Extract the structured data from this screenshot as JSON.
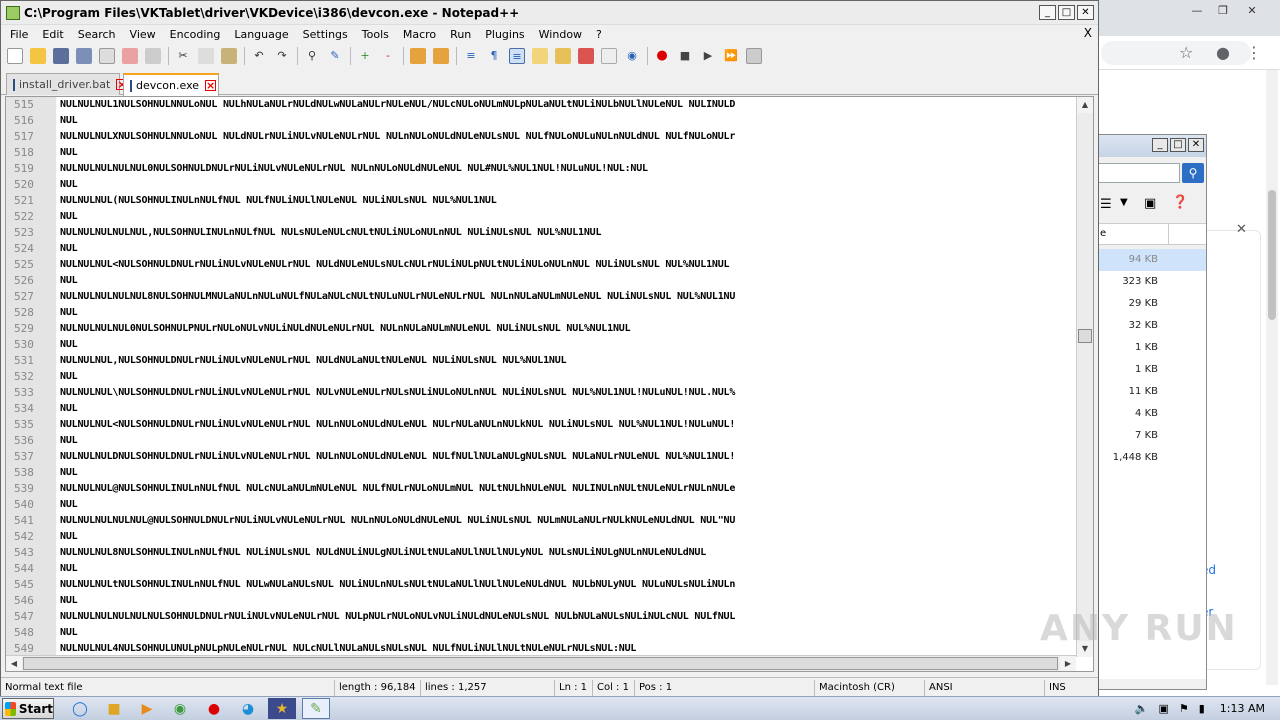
{
  "browser": {
    "links": [
      "ed",
      "er"
    ]
  },
  "explorer": {
    "col_header": "e",
    "sizes": [
      "94 KB",
      "323 KB",
      "29 KB",
      "32 KB",
      "1 KB",
      "1 KB",
      "11 KB",
      "4 KB",
      "7 KB",
      "1,448 KB"
    ]
  },
  "npp": {
    "title": "C:\\Program Files\\VKTablet\\driver\\VKDevice\\i386\\devcon.exe - Notepad++",
    "menu": [
      "File",
      "Edit",
      "Search",
      "View",
      "Encoding",
      "Language",
      "Settings",
      "Tools",
      "Macro",
      "Run",
      "Plugins",
      "Window",
      "?"
    ],
    "close_doc": "X",
    "tabs": [
      {
        "label": "install_driver.bat",
        "active": false
      },
      {
        "label": "devcon.exe",
        "active": true
      }
    ],
    "lines": [
      {
        "n": "515",
        "text": "NULNULNUL1NULSOHNULNNULoNUL  NULhNULaNULrNULdNULwNULaNULrNULeNUL/NULcNULoNULmNULpNULaNULtNULiNULbNULlNULeNUL  NULINULD"
      },
      {
        "n": "516",
        "text": "NUL"
      },
      {
        "n": "517",
        "text": "NULNULNULXNULSOHNULNNULoNUL  NULdNULrNULiNULvNULeNULrNUL  NULnNULoNULdNULeNULsNUL  NULfNULoNULuNULnNULdNUL  NULfNULoNULr"
      },
      {
        "n": "518",
        "text": "NUL"
      },
      {
        "n": "519",
        "text": "NULNULNULNULNUL0NULSOHNULDNULrNULiNULvNULeNULrNUL  NULnNULoNULdNULeNUL  NUL#NUL%NUL1NUL!NULuNUL!NUL:NUL"
      },
      {
        "n": "520",
        "text": "NUL"
      },
      {
        "n": "521",
        "text": "NULNULNUL(NULSOHNULINULnNULfNUL  NULfNULiNULlNULeNUL  NULiNULsNUL  NUL%NUL1NUL"
      },
      {
        "n": "522",
        "text": "NUL"
      },
      {
        "n": "523",
        "text": "NULNULNULNULNUL,NULSOHNULINULnNULfNUL  NULsNULeNULcNULtNULiNULoNULnNUL  NULiNULsNUL  NUL%NUL1NUL"
      },
      {
        "n": "524",
        "text": "NUL"
      },
      {
        "n": "525",
        "text": "NULNULNUL<NULSOHNULDNULrNULiNULvNULeNULrNUL  NULdNULeNULsNULcNULrNULiNULpNULtNULiNULoNULnNUL  NULiNULsNUL  NUL%NUL1NUL"
      },
      {
        "n": "526",
        "text": "NUL"
      },
      {
        "n": "527",
        "text": "NULNULNULNULNUL8NULSOHNULMNULaNULnNULuNULfNULaNULcNULtNULuNULrNULeNULrNUL  NULnNULaNULmNULeNUL  NULiNULsNUL  NUL%NUL1NU"
      },
      {
        "n": "528",
        "text": "NUL"
      },
      {
        "n": "529",
        "text": "NULNULNULNUL0NULSOHNULPNULrNULoNULvNULiNULdNULeNULrNUL  NULnNULaNULmNULeNUL  NULiNULsNUL  NUL%NUL1NUL"
      },
      {
        "n": "530",
        "text": "NUL"
      },
      {
        "n": "531",
        "text": "NULNULNUL,NULSOHNULDNULrNULiNULvNULeNULrNUL  NULdNULaNULtNULeNUL  NULiNULsNUL  NUL%NUL1NUL"
      },
      {
        "n": "532",
        "text": "NUL"
      },
      {
        "n": "533",
        "text": "NULNULNUL\\NULSOHNULDNULrNULiNULvNULeNULrNUL  NULvNULeNULrNULsNULiNULoNULnNUL  NULiNULsNUL  NUL%NUL1NUL!NULuNUL!NUL.NUL%"
      },
      {
        "n": "534",
        "text": "NUL"
      },
      {
        "n": "535",
        "text": "NULNULNUL<NULSOHNULDNULrNULiNULvNULeNULrNUL  NULnNULoNULdNULeNUL  NULrNULaNULnNULkNUL  NULiNULsNUL  NUL%NUL1NUL!NULuNUL!"
      },
      {
        "n": "536",
        "text": "NUL"
      },
      {
        "n": "537",
        "text": "NULNULNULDNULSOHNULDNULrNULiNULvNULeNULrNUL  NULnNULoNULdNULeNUL  NULfNULlNULaNULgNULsNUL  NULaNULrNULeNUL  NUL%NUL1NUL!"
      },
      {
        "n": "538",
        "text": "NUL"
      },
      {
        "n": "539",
        "text": "NULNULNUL@NULSOHNULINULnNULfNUL  NULcNULaNULmNULeNUL  NULfNULrNULoNULmNUL  NULtNULhNULeNUL  NULINULnNULtNULeNULrNULnNULe"
      },
      {
        "n": "540",
        "text": "NUL"
      },
      {
        "n": "541",
        "text": "NULNULNULNULNUL@NULSOHNULDNULrNULiNULvNULeNULrNUL  NULnNULoNULdNULeNUL  NULiNULsNUL  NULmNULaNULrNULkNULeNULdNUL  NUL\"NU"
      },
      {
        "n": "542",
        "text": "NUL"
      },
      {
        "n": "543",
        "text": "NULNULNUL8NULSOHNULINULnNULfNUL  NULiNULsNUL  NULdNULiNULgNULiNULtNULaNULlNULlNULyNUL  NULsNULiNULgNULnNULeNULdNUL"
      },
      {
        "n": "544",
        "text": "NUL"
      },
      {
        "n": "545",
        "text": "NULNULNULtNULSOHNULINULnNULfNUL  NULwNULaNULsNUL  NULiNULnNULsNULtNULaNULlNULlNULeNULdNUL  NULbNULyNUL  NULuNULsNULiNULn"
      },
      {
        "n": "546",
        "text": "NUL"
      },
      {
        "n": "547",
        "text": "NULNULNULNULNULNULSOHNULDNULrNULiNULvNULeNULrNUL  NULpNULrNULoNULvNULiNULdNULeNULsNUL  NULbNULaNULsNULiNULcNUL  NULfNUL"
      },
      {
        "n": "548",
        "text": "NUL"
      },
      {
        "n": "549",
        "text": "NULNULNUL4NULSOHNULUNULpNULpNULeNULrNUL  NULcNULlNULaNULsNULsNUL  NULfNULiNULlNULtNULeNULrNULsNUL:NUL"
      }
    ],
    "status": {
      "type": "Normal text file",
      "length": "length : 96,184",
      "lines": "lines : 1,257",
      "ln": "Ln : 1",
      "col": "Col : 1",
      "pos": "Pos : 1",
      "eol": "Macintosh (CR)",
      "encoding": "ANSI",
      "mode": "INS"
    }
  },
  "watermark": "ANY RUN",
  "taskbar": {
    "start": "Start",
    "clock": "1:13 AM"
  }
}
